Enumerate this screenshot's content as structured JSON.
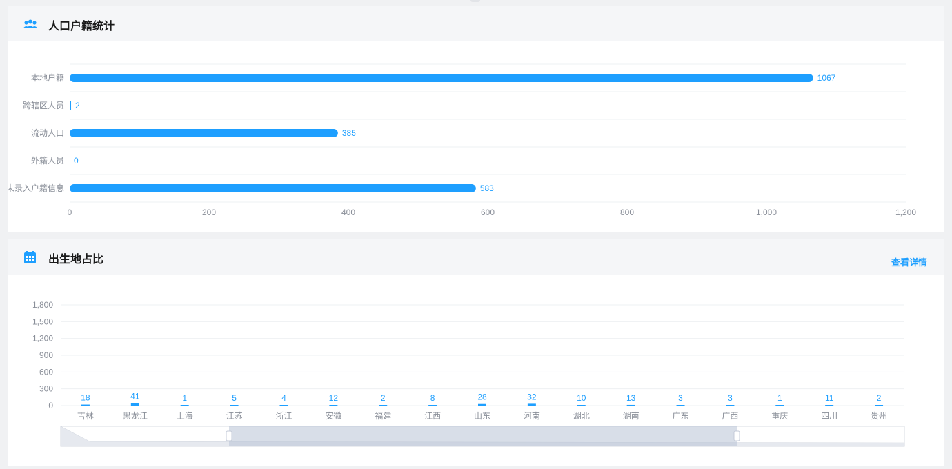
{
  "panel1": {
    "title": "人口户籍统计",
    "icon": "people-group-icon"
  },
  "panel2": {
    "title": "出生地占比",
    "icon": "calendar-icon",
    "detail_link": "查看详情"
  },
  "colors": {
    "accent": "#1e9fff",
    "axis_text": "#8a8f99",
    "grid": "#eef0f3",
    "header_bg": "#f5f6f8"
  },
  "chart_data": [
    {
      "type": "bar",
      "orientation": "horizontal",
      "categories": [
        "本地户籍",
        "跨辖区人员",
        "流动人口",
        "外籍人员",
        "未录入户籍信息"
      ],
      "values": [
        1067,
        2,
        385,
        0,
        583
      ],
      "xlim": [
        0,
        1200
      ],
      "xticks": [
        "0",
        "200",
        "400",
        "600",
        "800",
        "1,000",
        "1,200"
      ],
      "grid": true,
      "data_labels": true
    },
    {
      "type": "bar",
      "categories": [
        "吉林",
        "黑龙江",
        "上海",
        "江苏",
        "浙江",
        "安徽",
        "福建",
        "江西",
        "山东",
        "河南",
        "湖北",
        "湖南",
        "广东",
        "广西",
        "重庆",
        "四川",
        "贵州"
      ],
      "values": [
        18,
        41,
        1,
        5,
        4,
        12,
        2,
        8,
        28,
        32,
        10,
        13,
        3,
        3,
        1,
        11,
        2
      ],
      "ylim": [
        0,
        1800
      ],
      "yticks": [
        "0",
        "300",
        "600",
        "900",
        "1,200",
        "1,500",
        "1,800"
      ],
      "grid": true,
      "data_labels": true,
      "data_zoom": true
    }
  ]
}
